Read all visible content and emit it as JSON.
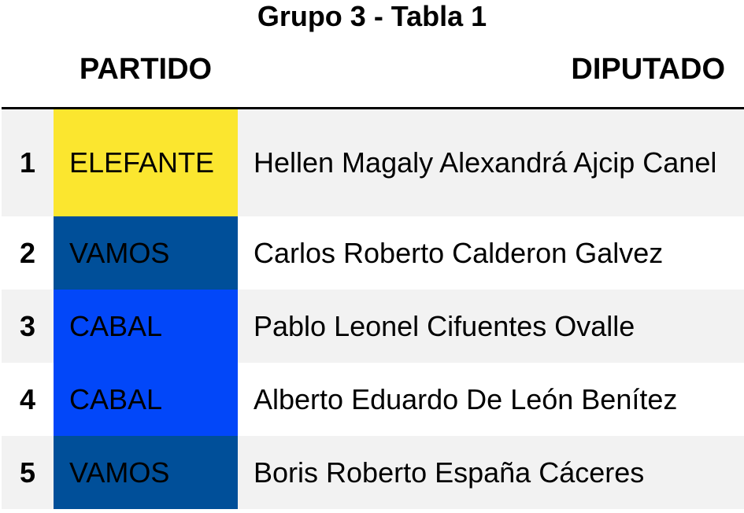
{
  "table_title": "Grupo 3 - Tabla 1",
  "headers": {
    "index": "",
    "party": "PARTIDO",
    "deputy": "DIPUTADO"
  },
  "rows": [
    {
      "index": "1",
      "party": "ELEFANTE",
      "deputy": "Hellen Magaly Alexandrá Ajcip Canel",
      "party_color": "#fbe62f"
    },
    {
      "index": "2",
      "party": "VAMOS",
      "deputy": "Carlos Roberto Calderon Galvez",
      "party_color": "#004f99"
    },
    {
      "index": "3",
      "party": "CABAL",
      "deputy": "Pablo Leonel Cifuentes Ovalle",
      "party_color": "#0247f9"
    },
    {
      "index": "4",
      "party": "CABAL",
      "deputy": "Alberto Eduardo De León Benítez",
      "party_color": "#0247f9"
    },
    {
      "index": "5",
      "party": "VAMOS",
      "deputy": "Boris Roberto España Cáceres",
      "party_color": "#004f99"
    }
  ]
}
